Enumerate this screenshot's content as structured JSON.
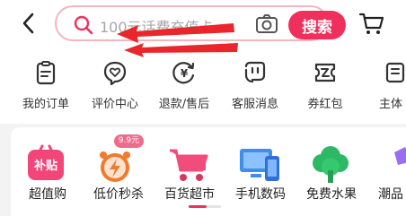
{
  "search": {
    "placeholder": "100元话费充值卡",
    "button_label": "搜索"
  },
  "quick_actions": [
    {
      "label": "我的订单",
      "icon": "clipboard-icon"
    },
    {
      "label": "评价中心",
      "icon": "heart-chat-icon"
    },
    {
      "label": "退款/售后",
      "icon": "yen-refund-icon"
    },
    {
      "label": "客服消息",
      "icon": "customer-service-icon"
    },
    {
      "label": "券红包",
      "icon": "coupon-icon"
    },
    {
      "label": "主体",
      "icon": "partial-icon"
    }
  ],
  "categories": [
    {
      "label": "超值购",
      "icon": "subsidy-tag-icon",
      "badge_text": "补贴"
    },
    {
      "label": "低价秒杀",
      "icon": "flash-sale-clock-icon",
      "badge_text": "9.9元"
    },
    {
      "label": "百货超市",
      "icon": "shopping-cart-icon"
    },
    {
      "label": "手机数码",
      "icon": "monitor-phone-icon"
    },
    {
      "label": "免费水果",
      "icon": "tree-icon"
    },
    {
      "label": "潮品",
      "icon": "partial-category-icon"
    }
  ],
  "colors": {
    "accent": "#ef2f5c",
    "search_border": "#f4b6be",
    "background": "#f3f3f3",
    "annotation_arrow": "#e8262b"
  }
}
